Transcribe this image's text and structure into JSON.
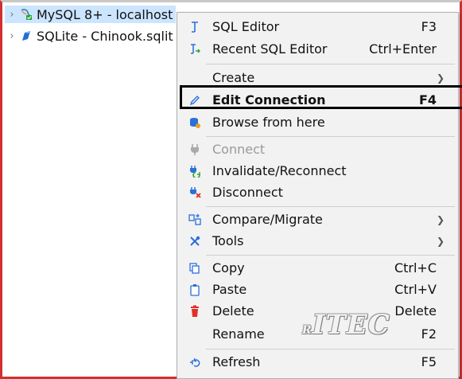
{
  "tree": {
    "items": [
      {
        "label": "MySQL 8+ - localhost",
        "icon": "mysql-icon",
        "selected": true
      },
      {
        "label": "SQLite - Chinook.sqlit",
        "icon": "sqlite-icon",
        "selected": false
      }
    ]
  },
  "menu": {
    "sql_editor": {
      "label": "SQL Editor",
      "shortcut": "F3"
    },
    "recent_sql_editor": {
      "label": "Recent SQL Editor",
      "shortcut": "Ctrl+Enter"
    },
    "create": {
      "label": "Create"
    },
    "edit_connection": {
      "label": "Edit Connection",
      "shortcut": "F4"
    },
    "browse": {
      "label": "Browse from here"
    },
    "connect": {
      "label": "Connect"
    },
    "invalidate": {
      "label": "Invalidate/Reconnect"
    },
    "disconnect": {
      "label": "Disconnect"
    },
    "compare": {
      "label": "Compare/Migrate"
    },
    "tools": {
      "label": "Tools"
    },
    "copy": {
      "label": "Copy",
      "shortcut": "Ctrl+C"
    },
    "paste": {
      "label": "Paste",
      "shortcut": "Ctrl+V"
    },
    "delete": {
      "label": "Delete",
      "shortcut": "Delete"
    },
    "rename": {
      "label": "Rename",
      "shortcut": "F2"
    },
    "refresh": {
      "label": "Refresh",
      "shortcut": "F5"
    }
  },
  "watermark": {
    "text": "ITEC",
    "prefix": "R"
  },
  "colors": {
    "menu_bg": "#f2f2f2",
    "selection_bg": "#cce5ff",
    "icon_blue": "#2a6fdb",
    "icon_red": "#e0302a",
    "frame_red": "#d03030"
  }
}
